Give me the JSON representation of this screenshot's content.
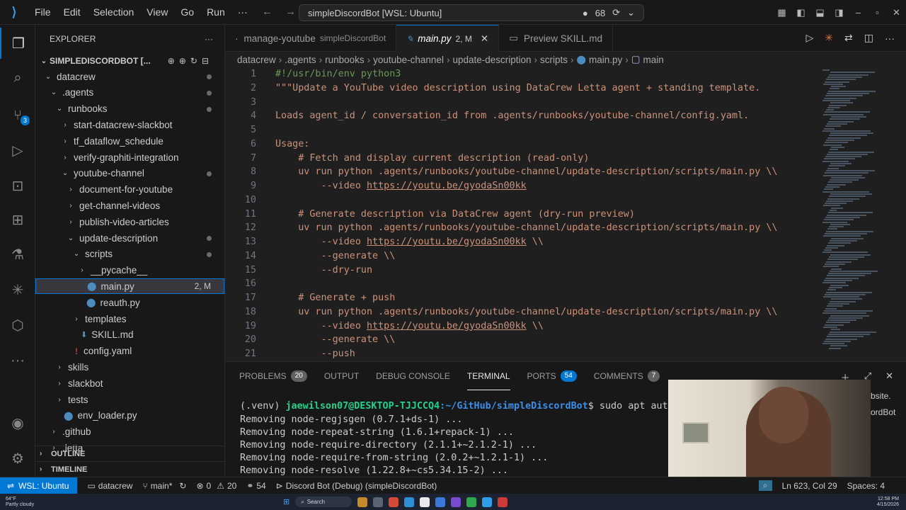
{
  "window": {
    "menu": [
      "File",
      "Edit",
      "Selection",
      "View",
      "Go",
      "Run"
    ],
    "command_center": "simpleDiscordBot [WSL: Ubuntu]",
    "copilot_count": "68"
  },
  "sidebar": {
    "title": "EXPLORER",
    "root": "SIMPLEDISCORDBOT [...",
    "items": [
      {
        "label": "datacrew",
        "indent": 1,
        "chev": "v",
        "dot": true
      },
      {
        "label": ".agents",
        "indent": 2,
        "chev": "v",
        "dot": true
      },
      {
        "label": "runbooks",
        "indent": 3,
        "chev": "v",
        "dot": true
      },
      {
        "label": "start-datacrew-slackbot",
        "indent": 4,
        "chev": ">"
      },
      {
        "label": "tf_dataflow_schedule",
        "indent": 4,
        "chev": ">"
      },
      {
        "label": "verify-graphiti-integration",
        "indent": 4,
        "chev": ">"
      },
      {
        "label": "youtube-channel",
        "indent": 4,
        "chev": "v",
        "dot": true
      },
      {
        "label": "document-for-youtube",
        "indent": 5,
        "chev": ">"
      },
      {
        "label": "get-channel-videos",
        "indent": 5,
        "chev": ">"
      },
      {
        "label": "publish-video-articles",
        "indent": 5,
        "chev": ">"
      },
      {
        "label": "update-description",
        "indent": 5,
        "chev": "v",
        "dot": true
      },
      {
        "label": "scripts",
        "indent": 6,
        "chev": "v",
        "dot": true
      },
      {
        "label": "__pycache__",
        "indent": 7,
        "chev": ">"
      },
      {
        "label": "main.py",
        "indent": 7,
        "icon": "python",
        "meta": "2, M",
        "selected": true
      },
      {
        "label": "reauth.py",
        "indent": 7,
        "icon": "python"
      },
      {
        "label": "templates",
        "indent": 6,
        "chev": ">"
      },
      {
        "label": "SKILL.md",
        "indent": 6,
        "icon": "markdown"
      },
      {
        "label": "config.yaml",
        "indent": 5,
        "icon": "yaml"
      },
      {
        "label": "skills",
        "indent": 3,
        "chev": ">"
      },
      {
        "label": "slackbot",
        "indent": 3,
        "chev": ">"
      },
      {
        "label": "tests",
        "indent": 3,
        "chev": ">"
      },
      {
        "label": "env_loader.py",
        "indent": 3,
        "icon": "python"
      },
      {
        "label": ".github",
        "indent": 2,
        "chev": ">"
      },
      {
        "label": ".letta",
        "indent": 2,
        "chev": ">"
      }
    ],
    "outline": "OUTLINE",
    "timeline": "TIMELINE"
  },
  "tabs": [
    {
      "label": "manage-youtube",
      "sub": "simpleDiscordBot",
      "active": false
    },
    {
      "label": "main.py",
      "mod": "2, M",
      "active": true
    },
    {
      "label": "Preview SKILL.md",
      "active": false
    }
  ],
  "breadcrumb": [
    "datacrew",
    ".agents",
    "runbooks",
    "youtube-channel",
    "update-description",
    "scripts",
    "main.py",
    "main"
  ],
  "editor": {
    "lines": [
      {
        "n": "1",
        "text": "#!/usr/bin/env python3",
        "cls": ""
      },
      {
        "n": "2",
        "text": "\"\"\"Update a YouTube video description using DataCrew Letta agent + standing template.",
        "cls": ""
      },
      {
        "n": "3",
        "text": "",
        "cls": ""
      },
      {
        "n": "4",
        "text": "Loads agent_id / conversation_id from .agents/runbooks/youtube-channel/config.yaml.",
        "cls": ""
      },
      {
        "n": "5",
        "text": "",
        "cls": ""
      },
      {
        "n": "6",
        "text": "Usage:",
        "cls": ""
      },
      {
        "n": "7",
        "text": "    # Fetch and display current description (read-only)",
        "cls": ""
      },
      {
        "n": "8",
        "text": "    uv run python .agents/runbooks/youtube-channel/update-description/scripts/main.py \\\\",
        "cls": ""
      },
      {
        "n": "9",
        "text": "        --video ",
        "url": "https://youtu.be/gyodaSn00kk",
        "tail": "",
        "cls": ""
      },
      {
        "n": "10",
        "text": "",
        "cls": ""
      },
      {
        "n": "11",
        "text": "    # Generate description via DataCrew agent (dry-run preview)",
        "cls": ""
      },
      {
        "n": "12",
        "text": "    uv run python .agents/runbooks/youtube-channel/update-description/scripts/main.py \\\\",
        "cls": ""
      },
      {
        "n": "13",
        "text": "        --video ",
        "url": "https://youtu.be/gyodaSn00kk",
        "tail": " \\\\",
        "cls": ""
      },
      {
        "n": "14",
        "text": "        --generate \\\\",
        "cls": ""
      },
      {
        "n": "15",
        "text": "        --dry-run",
        "cls": ""
      },
      {
        "n": "16",
        "text": "",
        "cls": ""
      },
      {
        "n": "17",
        "text": "    # Generate + push",
        "cls": ""
      },
      {
        "n": "18",
        "text": "    uv run python .agents/runbooks/youtube-channel/update-description/scripts/main.py \\\\",
        "cls": ""
      },
      {
        "n": "19",
        "text": "        --video ",
        "url": "https://youtu.be/gyodaSn00kk",
        "tail": " \\\\",
        "cls": ""
      },
      {
        "n": "20",
        "text": "        --generate \\\\",
        "cls": ""
      },
      {
        "n": "21",
        "text": "        --push",
        "cls": ""
      }
    ]
  },
  "panel": {
    "tabs": [
      {
        "label": "PROBLEMS",
        "badge": "20"
      },
      {
        "label": "OUTPUT"
      },
      {
        "label": "DEBUG CONSOLE"
      },
      {
        "label": "TERMINAL",
        "active": true
      },
      {
        "label": "PORTS",
        "badge": "54"
      },
      {
        "label": "COMMENTS",
        "badge": "7"
      }
    ],
    "prompt_env": "(.venv) ",
    "prompt_user": "jaewilson07@DESKTOP-TJJCCQ4",
    "prompt_path": ":~/GitHub/simpleDiscordBot",
    "prompt_cmd": "$ sudo apt autoremov",
    "output": [
      "Removing node-regjsgen (0.7.1+ds-1) ...",
      "Removing node-repeat-string (1.6.1+repack-1) ...",
      "Removing node-require-directory (2.1.1+~2.1.2-1) ...",
      "Removing node-require-from-string (2.0.2+~1.2.1-1) ...",
      "Removing node-resolve (1.22.8+~cs5.34.15-2) ..."
    ],
    "side_frag1": "bsite.",
    "side_frag2": "ordBot"
  },
  "statusbar": {
    "remote": "WSL: Ubuntu",
    "folder": "datacrew",
    "branch": "main*",
    "errors": "0",
    "warnings": "20",
    "ports": "54",
    "debug": "Discord Bot (Debug) (simpleDiscordBot)",
    "cursor": "Ln 623, Col 29",
    "spaces": "Spaces: 4"
  },
  "taskbar": {
    "temp": "64°F",
    "weather": "Partly cloudy",
    "search": "Search",
    "time": "12:58 PM",
    "date": "4/15/2026"
  },
  "colors": {
    "accent": "#0078d4",
    "comment_green": "#6a9955",
    "string_orange": "#ce9178"
  }
}
